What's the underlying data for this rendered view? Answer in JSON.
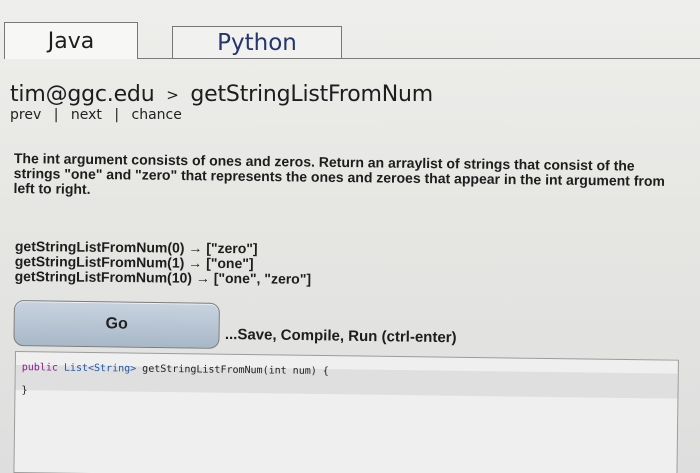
{
  "tabs": {
    "java_label": "Java",
    "python_label": "Python"
  },
  "breadcrumb": {
    "user": "tim@ggc.edu",
    "separator": ">",
    "problem": "getStringListFromNum"
  },
  "nav": {
    "prev": "prev",
    "separator1": "|",
    "next": "next",
    "separator2": "|",
    "chance": "chance"
  },
  "description": "The int argument consists of ones and zeros. Return an arraylist of strings that consist of the strings \"one\" and \"zero\" that represents the ones and zeroes that appear in the int argument from left to right.",
  "examples": [
    "getStringListFromNum(0) → [\"zero\"]",
    "getStringListFromNum(1) → [\"one\"]",
    "getStringListFromNum(10) → [\"one\", \"zero\"]"
  ],
  "actions": {
    "go_label": "Go",
    "save_hint": "...Save, Compile, Run (ctrl-enter)"
  },
  "editor": {
    "line1_keyword": "public",
    "line1_type": "List<String>",
    "line1_name": "getStringListFromNum(int num) {",
    "line2": "}"
  }
}
